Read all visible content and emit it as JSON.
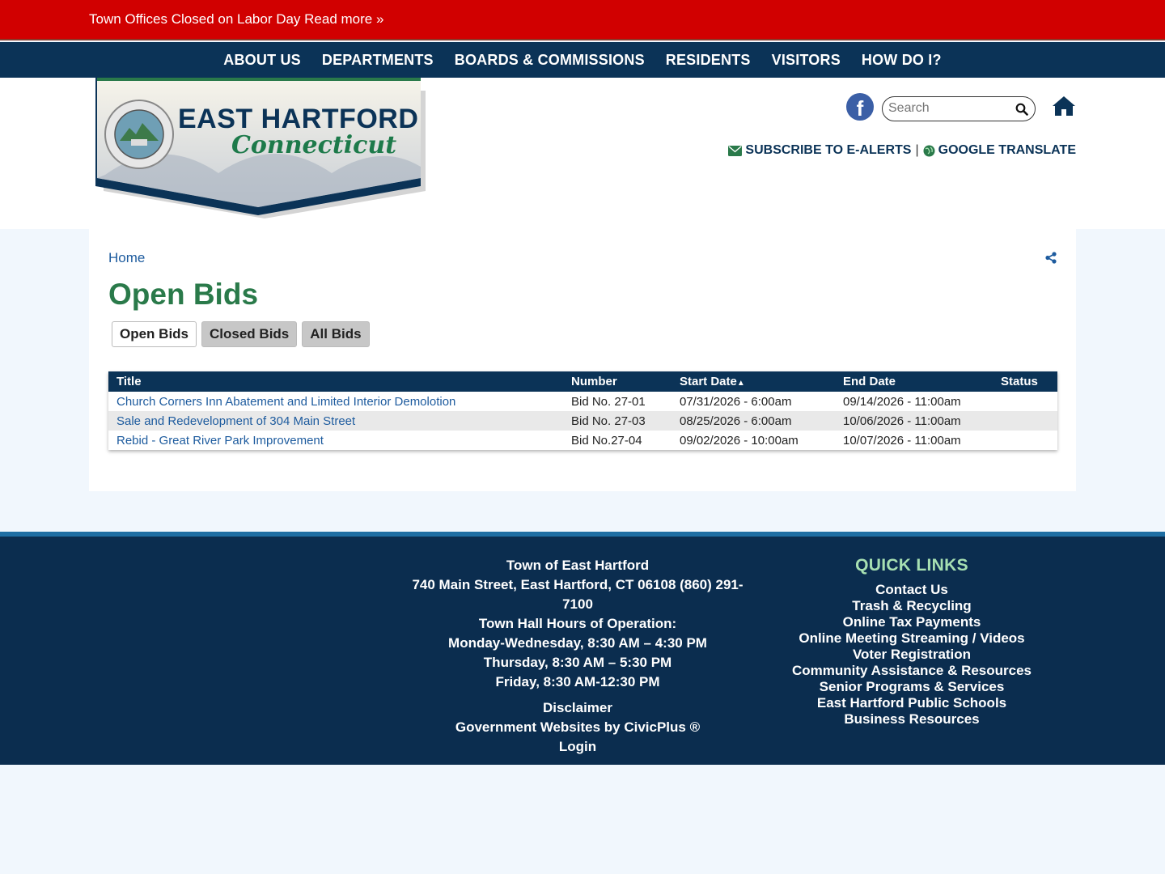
{
  "alert": {
    "text": "Town Offices Closed on Labor Day Read more »"
  },
  "nav": [
    "ABOUT US",
    "DEPARTMENTS",
    "BOARDS & COMMISSIONS",
    "RESIDENTS",
    "VISITORS",
    "HOW DO I?"
  ],
  "logo": {
    "title": "EAST HARTFORD",
    "subtitle": "Connecticut"
  },
  "search": {
    "placeholder": "Search"
  },
  "utility": {
    "subscribe": "SUBSCRIBE TO E-ALERTS",
    "separator": "|",
    "translate": "GOOGLE TRANSLATE"
  },
  "breadcrumb": {
    "home": "Home"
  },
  "page": {
    "title": "Open Bids"
  },
  "tabs": [
    "Open Bids",
    "Closed Bids",
    "All Bids"
  ],
  "table": {
    "headers": [
      "Title",
      "Number",
      "Start Date",
      "End Date",
      "Status"
    ],
    "sort_indicator": "▲",
    "rows": [
      [
        "Church Corners Inn Abatement and Limited Interior Demolotion",
        "Bid No. 27-01",
        "07/31/2026 - 6:00am",
        "09/14/2026 - 11:00am",
        ""
      ],
      [
        "Sale and Redevelopment of 304 Main Street",
        "Bid No. 27-03",
        "08/25/2026 - 6:00am",
        "10/06/2026 - 11:00am",
        ""
      ],
      [
        "Rebid - Great River Park Improvement",
        "Bid No.27-04",
        "09/02/2026 - 10:00am",
        "10/07/2026 - 11:00am",
        ""
      ]
    ]
  },
  "footer": {
    "contact": [
      "Town of East Hartford",
      "740 Main Street, East Hartford, CT 06108  (860) 291-7100",
      "Town Hall Hours of Operation:",
      "Monday-Wednesday, 8:30 AM – 4:30 PM",
      "Thursday, 8:30 AM – 5:30 PM",
      "Friday, 8:30 AM-12:30 PM"
    ],
    "links": [
      "Disclaimer",
      "Government Websites by CivicPlus ®",
      "Login"
    ],
    "quick_links_title": "QUICK LINKS",
    "quick_links": [
      "Contact Us",
      "Trash & Recycling",
      "Online Tax Payments",
      "Online Meeting Streaming / Videos",
      "Voter Registration",
      "Community Assistance & Resources",
      "Senior Programs & Services",
      "East Hartford Public Schools",
      "Business Resources"
    ]
  },
  "colors": {
    "navy": "#0b3357",
    "alert_red": "#d10000",
    "green": "#2a7a4a",
    "link_blue": "#1d5b9e"
  }
}
